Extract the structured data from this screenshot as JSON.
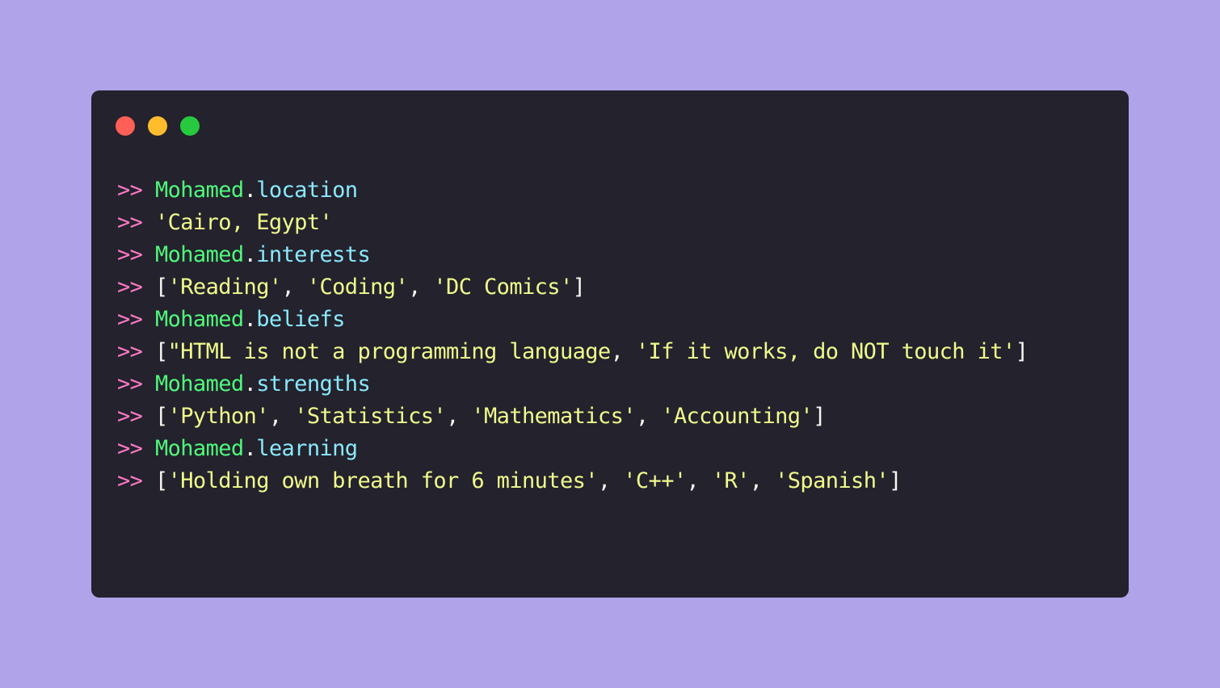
{
  "window": {
    "controls": {
      "close": {
        "color": "#ff5f56"
      },
      "minimize": {
        "color": "#ffbd2e"
      },
      "maximize": {
        "color": "#27c93f"
      }
    }
  },
  "prompt": ">>",
  "object": "Mohamed",
  "lines": [
    {
      "type": "access",
      "attribute": "location"
    },
    {
      "type": "output",
      "tokens": [
        {
          "k": "str",
          "t": "'Cairo, Egypt'"
        }
      ]
    },
    {
      "type": "access",
      "attribute": "interests"
    },
    {
      "type": "output",
      "tokens": [
        {
          "k": "punct",
          "t": "["
        },
        {
          "k": "str",
          "t": "'Reading'"
        },
        {
          "k": "punct",
          "t": ", "
        },
        {
          "k": "str",
          "t": "'Coding'"
        },
        {
          "k": "punct",
          "t": ", "
        },
        {
          "k": "str",
          "t": "'DC Comics'"
        },
        {
          "k": "punct",
          "t": "]"
        }
      ]
    },
    {
      "type": "access",
      "attribute": "beliefs"
    },
    {
      "type": "output",
      "tokens": [
        {
          "k": "punct",
          "t": "["
        },
        {
          "k": "str",
          "t": "\"HTML is not a programming language"
        },
        {
          "k": "punct",
          "t": ", "
        },
        {
          "k": "str",
          "t": "'If it works, do NOT touch it'"
        },
        {
          "k": "punct",
          "t": "]"
        }
      ]
    },
    {
      "type": "access",
      "attribute": "strengths"
    },
    {
      "type": "output",
      "tokens": [
        {
          "k": "punct",
          "t": "["
        },
        {
          "k": "str",
          "t": "'Python'"
        },
        {
          "k": "punct",
          "t": ", "
        },
        {
          "k": "str",
          "t": "'Statistics'"
        },
        {
          "k": "punct",
          "t": ", "
        },
        {
          "k": "str",
          "t": "'Mathematics'"
        },
        {
          "k": "punct",
          "t": ", "
        },
        {
          "k": "str",
          "t": "'Accounting'"
        },
        {
          "k": "punct",
          "t": "]"
        }
      ]
    },
    {
      "type": "access",
      "attribute": "learning"
    },
    {
      "type": "output",
      "tokens": [
        {
          "k": "punct",
          "t": "["
        },
        {
          "k": "str",
          "t": "'Holding own breath for 6 minutes'"
        },
        {
          "k": "punct",
          "t": ", "
        },
        {
          "k": "str",
          "t": "'C++'"
        },
        {
          "k": "punct",
          "t": ", "
        },
        {
          "k": "str",
          "t": "'R'"
        },
        {
          "k": "punct",
          "t": ", "
        },
        {
          "k": "str",
          "t": "'Spanish'"
        },
        {
          "k": "punct",
          "t": "]"
        }
      ]
    }
  ]
}
